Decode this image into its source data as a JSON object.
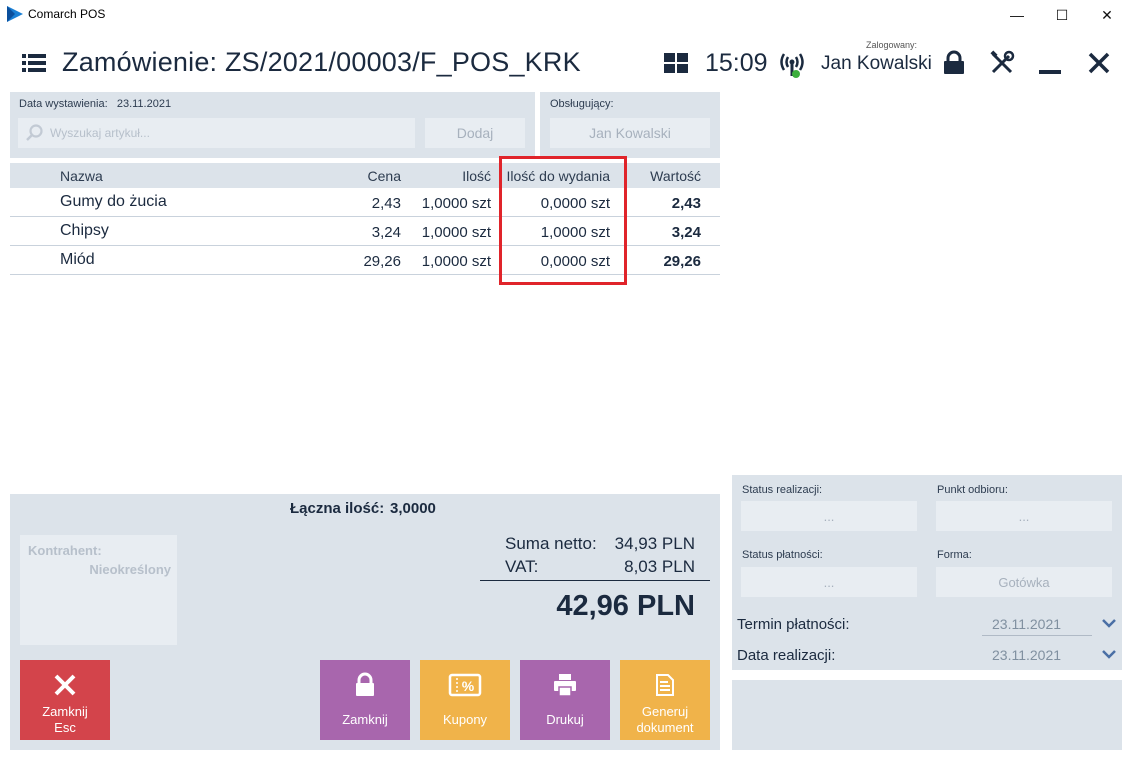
{
  "window": {
    "title": "Comarch POS",
    "minimize_glyph": "—",
    "maximize_glyph": "☐",
    "close_glyph": "✕"
  },
  "header": {
    "title": "Zamówienie: ZS/2021/00003/F_POS_KRK",
    "time": "15:09",
    "logged_label": "Zalogowany:",
    "user": "Jan Kowalski"
  },
  "order": {
    "date_label": "Data wystawienia:",
    "date_value": "23.11.2021",
    "search_placeholder": "Wyszukaj artykuł...",
    "add_label": "Dodaj",
    "served_label": "Obsługujący:",
    "served_value": "Jan Kowalski"
  },
  "table": {
    "columns": [
      "Nazwa",
      "Cena",
      "Ilość",
      "Ilość do wydania",
      "Wartość"
    ],
    "rows": [
      {
        "name": "Gumy do żucia",
        "price": "2,43",
        "qty": "1,0000 szt",
        "to_issue": "0,0000 szt",
        "value": "2,43"
      },
      {
        "name": "Chipsy",
        "price": "3,24",
        "qty": "1,0000 szt",
        "to_issue": "1,0000 szt",
        "value": "3,24"
      },
      {
        "name": "Miód",
        "price": "29,26",
        "qty": "1,0000 szt",
        "to_issue": "0,0000 szt",
        "value": "29,26"
      }
    ]
  },
  "totals": {
    "total_qty_label": "Łączna ilość:",
    "total_qty_value": "3,0000",
    "net_label": "Suma netto:",
    "net_value": "34,93 PLN",
    "vat_label": "VAT:",
    "vat_value": "8,03 PLN",
    "grand_total": "42,96 PLN"
  },
  "contractor": {
    "label": "Kontrahent:",
    "value": "Nieokreślony"
  },
  "actions": {
    "close_label_1": "Zamknij",
    "close_label_2": "Esc",
    "lock_label": "Zamknij",
    "coupons_label": "Kupony",
    "print_label": "Drukuj",
    "generate_label_1": "Generuj",
    "generate_label_2": "dokument"
  },
  "details": {
    "status_realization_label": "Status realizacji:",
    "status_realization_value": "...",
    "pickup_label": "Punkt odbioru:",
    "pickup_value": "...",
    "payment_status_label": "Status płatności:",
    "payment_status_value": "...",
    "form_label": "Forma:",
    "form_value": "Gotówka",
    "payment_term_label": "Termin płatności:",
    "payment_term_value": "23.11.2021",
    "realization_date_label": "Data realizacji:",
    "realization_date_value": "23.11.2021"
  },
  "colors": {
    "accent_dark": "#1b2a3f",
    "panel": "#dce3ea",
    "close_red": "#d3444b",
    "purple": "#a866ad",
    "orange": "#f0b34a",
    "highlight_red": "#e0242a"
  }
}
